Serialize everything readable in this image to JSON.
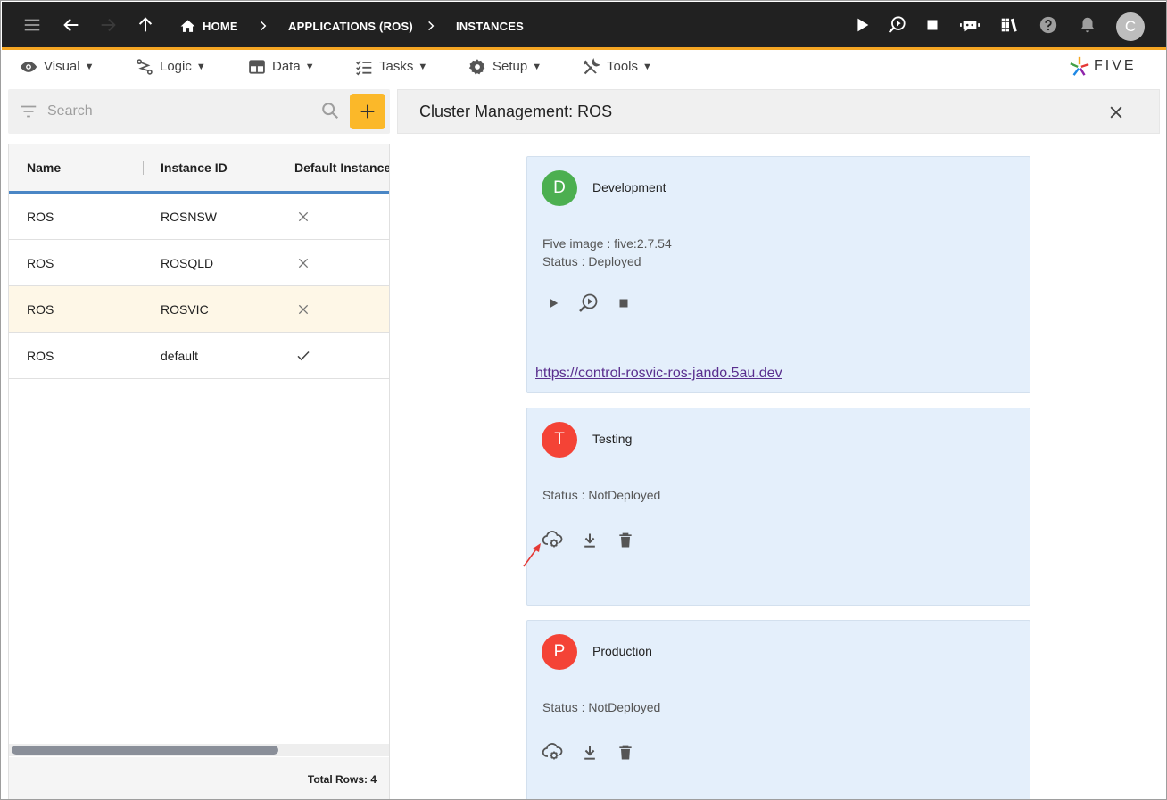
{
  "topbar": {
    "breadcrumbs": [
      {
        "label": "HOME",
        "icon": "home-icon"
      },
      {
        "label": "APPLICATIONS (ROS)"
      },
      {
        "label": "INSTANCES"
      }
    ],
    "user_initial": "C"
  },
  "menu": {
    "items": [
      {
        "label": "Visual",
        "icon": "eye-icon"
      },
      {
        "label": "Logic",
        "icon": "logic-icon"
      },
      {
        "label": "Data",
        "icon": "table-icon"
      },
      {
        "label": "Tasks",
        "icon": "checklist-icon"
      },
      {
        "label": "Setup",
        "icon": "gear-icon"
      },
      {
        "label": "Tools",
        "icon": "tools-icon"
      }
    ],
    "caret": "▼",
    "logo_text": "FIVE"
  },
  "search": {
    "placeholder": "Search",
    "value": ""
  },
  "grid": {
    "columns": [
      "Name",
      "Instance ID",
      "Default Instance"
    ],
    "rows": [
      {
        "name": "ROS",
        "instance_id": "ROSNSW",
        "default": false
      },
      {
        "name": "ROS",
        "instance_id": "ROSQLD",
        "default": false
      },
      {
        "name": "ROS",
        "instance_id": "ROSVIC",
        "default": false,
        "selected": true
      },
      {
        "name": "ROS",
        "instance_id": "default",
        "default": true
      }
    ],
    "total_rows_label": "Total Rows: 4"
  },
  "detail": {
    "title": "Cluster Management: ROS",
    "environments": [
      {
        "initial": "D",
        "name": "Development",
        "color": "#4caf50",
        "image_line": "Five image : five:2.7.54",
        "status_line": "Status : Deployed",
        "url": "https://control-rosvic-ros-jando.5au.dev"
      },
      {
        "initial": "T",
        "name": "Testing",
        "color": "#f44336",
        "status_line": "Status : NotDeployed"
      },
      {
        "initial": "P",
        "name": "Production",
        "color": "#f44336",
        "status_line": "Status : NotDeployed"
      }
    ]
  },
  "colors": {
    "accent": "#f5a623",
    "add_button": "#fbb829",
    "header_blue": "#4a86c5",
    "annotation": "#e53935"
  }
}
